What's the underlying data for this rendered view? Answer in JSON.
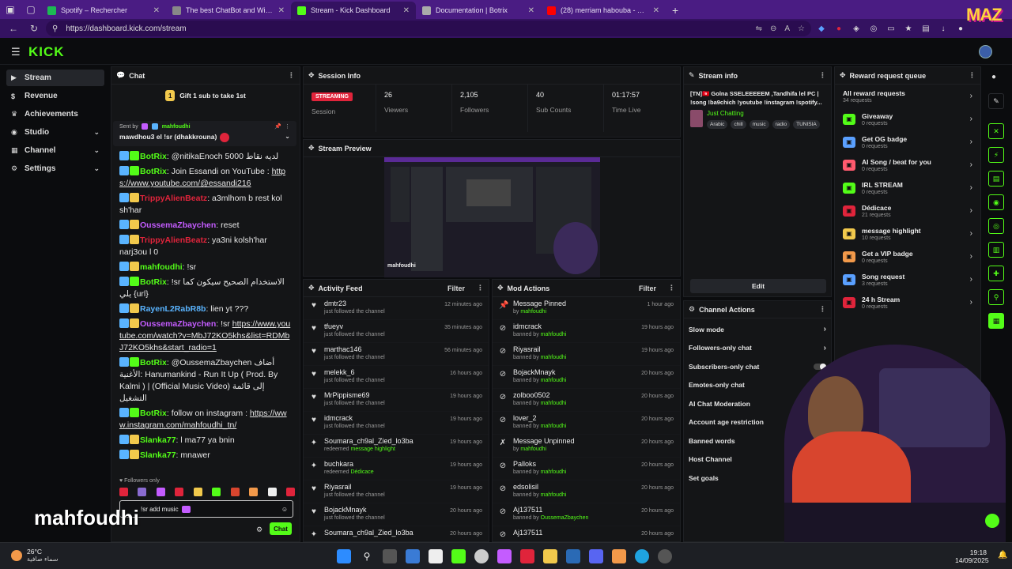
{
  "tabs": [
    {
      "label": "Spotify – Rechercher",
      "color": "#1db954"
    },
    {
      "label": "The best ChatBot and Widge",
      "color": "#888888"
    },
    {
      "label": "Stream - Kick Dashboard",
      "color": "#53fc18"
    },
    {
      "label": "Documentation | Botrix",
      "color": "#aaaaaa"
    },
    {
      "label": "(28) merriam habouba - YouTube",
      "color": "#ff0000"
    }
  ],
  "url": "https://dashboard.kick.com/stream",
  "logo": "KICK",
  "sidebar": [
    {
      "label": "Stream",
      "icon": "stream-icon",
      "active": true,
      "chev": false
    },
    {
      "label": "Revenue",
      "icon": "revenue-icon",
      "active": false,
      "chev": false
    },
    {
      "label": "Achievements",
      "icon": "trophy-icon",
      "active": false,
      "chev": false
    },
    {
      "label": "Studio",
      "icon": "studio-icon",
      "active": false,
      "chev": true
    },
    {
      "label": "Channel",
      "icon": "channel-icon",
      "active": false,
      "chev": true
    },
    {
      "label": "Settings",
      "icon": "gear-icon",
      "active": false,
      "chev": true
    }
  ],
  "chat": {
    "title": "Chat",
    "gift": "Gift 1 sub to take 1st",
    "gift_count": "1",
    "pinned_by_prefix": "Sent by",
    "pinned_by": "mahfoudhi",
    "pinned_msg": "mawdhou3 el !sr (dhakkrouna)",
    "followers_only": "Followers only",
    "input": "!sr add music",
    "send": "Chat",
    "messages": [
      {
        "user": "BotRix",
        "color": "#53fc18",
        "text": "@nitikaEnoch 5000 لديه نقاط",
        "link": ""
      },
      {
        "user": "BotRix",
        "color": "#53fc18",
        "text": "Join Essandi on YouTube :",
        "link": "https://www.youtube.com/@essandi216"
      },
      {
        "user": "TrippyAlienBeatz",
        "color": "#e0243b",
        "text": "a3mlhom b rest kol sh'har",
        "link": ""
      },
      {
        "user": "OussemaZbaychen",
        "color": "#c45cff",
        "text": "reset",
        "link": ""
      },
      {
        "user": "TrippyAlienBeatz",
        "color": "#e0243b",
        "text": "ya3ni kolsh'har narj3ou l 0",
        "link": ""
      },
      {
        "user": "mahfoudhi",
        "color": "#53fc18",
        "text": "!sr",
        "link": ""
      },
      {
        "user": "BotRix",
        "color": "#53fc18",
        "text": "!sr الاستخدام الصحيح سيكون كما يلي {url}",
        "link": ""
      },
      {
        "user": "RayenL2RabR8b",
        "color": "#5ab4ff",
        "text": "lien yt ???",
        "link": ""
      },
      {
        "user": "OussemaZbaychen",
        "color": "#c45cff",
        "text": "!sr",
        "link": "https://www.youtube.com/watch?v=MbJ72KO5khs&list=RDMbJ72KO5khs&start_radio=1"
      },
      {
        "user": "BotRix",
        "color": "#53fc18",
        "text": "@OussemaZbaychen أضاف الأغنية: Hanumankind - Run It Up ( Prod. By Kalmi ) | (Official Music Video) إلى قائمة التشغيل",
        "link": ""
      },
      {
        "user": "BotRix",
        "color": "#53fc18",
        "text": "follow on instagram :",
        "link": "https://www.instagram.com/mahfoudhi_tn/"
      },
      {
        "user": "Slanka77",
        "color": "#53fc18",
        "text": "l ma77 ya bnin",
        "link": ""
      },
      {
        "user": "Slanka77",
        "color": "#53fc18",
        "text": "mnawer",
        "link": ""
      }
    ]
  },
  "session": {
    "title": "Session Info",
    "status": "STREAMING",
    "status_label": "Session",
    "stats": [
      {
        "value": "26",
        "label": "Viewers"
      },
      {
        "value": "2,105",
        "label": "Followers"
      },
      {
        "value": "40",
        "label": "Sub Counts"
      },
      {
        "value": "01:17:57",
        "label": "Time Live"
      }
    ]
  },
  "preview": {
    "title": "Stream Preview",
    "name": "mahfoudhi"
  },
  "stream_info": {
    "title": "Stream info",
    "stream_title": "[TN]🇹🇳 Golna SSELEEEEEM ,Tandhifa lel PC | !song !ba9chich !youtube !instagram !spotify...",
    "category": "Just Chatting",
    "tags": [
      "Arabic",
      "chill",
      "music",
      "radio",
      "TUNISIA"
    ],
    "edit": "Edit"
  },
  "activity": {
    "title": "Activity Feed",
    "filter": "Filter",
    "items": [
      {
        "name": "dmtr23",
        "sub": "just followed the channel",
        "hl": "",
        "time": "12 minutes ago",
        "icon": "heart"
      },
      {
        "name": "tfueyv",
        "sub": "just followed the channel",
        "hl": "",
        "time": "35 minutes ago",
        "icon": "heart"
      },
      {
        "name": "marthac146",
        "sub": "just followed the channel",
        "hl": "",
        "time": "56 minutes ago",
        "icon": "heart"
      },
      {
        "name": "melekk_6",
        "sub": "just followed the channel",
        "hl": "",
        "time": "16 hours ago",
        "icon": "heart"
      },
      {
        "name": "MrPippisme69",
        "sub": "just followed the channel",
        "hl": "",
        "time": "19 hours ago",
        "icon": "heart"
      },
      {
        "name": "idmcrack",
        "sub": "just followed the channel",
        "hl": "",
        "time": "19 hours ago",
        "icon": "heart"
      },
      {
        "name": "Soumara_ch9al_Zied_lo3ba",
        "sub": "redeemed",
        "hl": "message highlight",
        "time": "19 hours ago",
        "icon": "redeem"
      },
      {
        "name": "buchkara",
        "sub": "redeemed",
        "hl": "Dédicace",
        "time": "19 hours ago",
        "icon": "redeem"
      },
      {
        "name": "Riyasrail",
        "sub": "just followed the channel",
        "hl": "",
        "time": "19 hours ago",
        "icon": "heart"
      },
      {
        "name": "BojackMnayk",
        "sub": "just followed the channel",
        "hl": "",
        "time": "20 hours ago",
        "icon": "heart"
      },
      {
        "name": "Soumara_ch9al_Zied_lo3ba",
        "sub": "",
        "hl": "",
        "time": "20 hours ago",
        "icon": "redeem"
      }
    ]
  },
  "mod": {
    "title": "Mod Actions",
    "filter": "Filter",
    "items": [
      {
        "name": "Message Pinned",
        "sub": "by",
        "who": "mahfoudhi",
        "time": "1 hour ago",
        "icon": "pin"
      },
      {
        "name": "idmcrack",
        "sub": "banned by",
        "who": "mahfoudhi",
        "time": "19 hours ago",
        "icon": "ban"
      },
      {
        "name": "Riyasrail",
        "sub": "banned by",
        "who": "mahfoudhi",
        "time": "19 hours ago",
        "icon": "ban"
      },
      {
        "name": "BojackMnayk",
        "sub": "banned by",
        "who": "mahfoudhi",
        "time": "20 hours ago",
        "icon": "ban"
      },
      {
        "name": "zolboo0502",
        "sub": "banned by",
        "who": "mahfoudhi",
        "time": "20 hours ago",
        "icon": "ban"
      },
      {
        "name": "lover_2",
        "sub": "banned by",
        "who": "mahfoudhi",
        "time": "20 hours ago",
        "icon": "ban"
      },
      {
        "name": "Message Unpinned",
        "sub": "by",
        "who": "mahfoudhi",
        "time": "20 hours ago",
        "icon": "unpin"
      },
      {
        "name": "Palloks",
        "sub": "banned by",
        "who": "mahfoudhi",
        "time": "20 hours ago",
        "icon": "ban"
      },
      {
        "name": "edsolisil",
        "sub": "banned by",
        "who": "mahfoudhi",
        "time": "20 hours ago",
        "icon": "ban"
      },
      {
        "name": "Aj137511",
        "sub": "banned by",
        "who": "OussemaZbaychen",
        "time": "20 hours ago",
        "icon": "ban"
      },
      {
        "name": "Aj137511",
        "sub": "",
        "who": "",
        "time": "20 hours ago",
        "icon": "ban"
      }
    ]
  },
  "channel_actions": {
    "title": "Channel Actions",
    "items": [
      {
        "label": "Slow mode",
        "chev": true
      },
      {
        "label": "Followers-only chat",
        "chev": true
      },
      {
        "label": "Subscribers-only chat",
        "chev": false
      },
      {
        "label": "Emotes-only chat",
        "chev": false
      },
      {
        "label": "AI Chat Moderation",
        "chev": false
      },
      {
        "label": "Account age restriction",
        "chev": false
      },
      {
        "label": "Banned words",
        "chev": false
      },
      {
        "label": "Host Channel",
        "chev": false
      },
      {
        "label": "Set goals",
        "chev": false
      }
    ]
  },
  "rewards": {
    "title": "Reward request queue",
    "items": [
      {
        "name": "All reward requests",
        "count": "34 requests",
        "color": ""
      },
      {
        "name": "Giveaway",
        "count": "0 requests",
        "color": "#53fc18"
      },
      {
        "name": "Get OG badge",
        "count": "0 requests",
        "color": "#5aa0ff"
      },
      {
        "name": "AI Song / beat for you",
        "count": "0 requests",
        "color": "#ff5a6e"
      },
      {
        "name": "IRL STREAM",
        "count": "0 requests",
        "color": "#53fc18"
      },
      {
        "name": "Dédicace",
        "count": "21 requests",
        "color": "#e0243b"
      },
      {
        "name": "message highlight",
        "count": "10 requests",
        "color": "#f2c94c"
      },
      {
        "name": "Get a VIP badge",
        "count": "0 requests",
        "color": "#f2994a"
      },
      {
        "name": "Song request",
        "count": "3 requests",
        "color": "#5aa0ff"
      },
      {
        "name": "24 h Stream",
        "count": "0 requests",
        "color": "#e0243b"
      }
    ]
  },
  "overlay_name": "mahfoudhi",
  "taskbar": {
    "weather_temp": "26°C",
    "weather_desc": "سماء صافية",
    "time": "19:18",
    "date": "14/09/2025"
  }
}
